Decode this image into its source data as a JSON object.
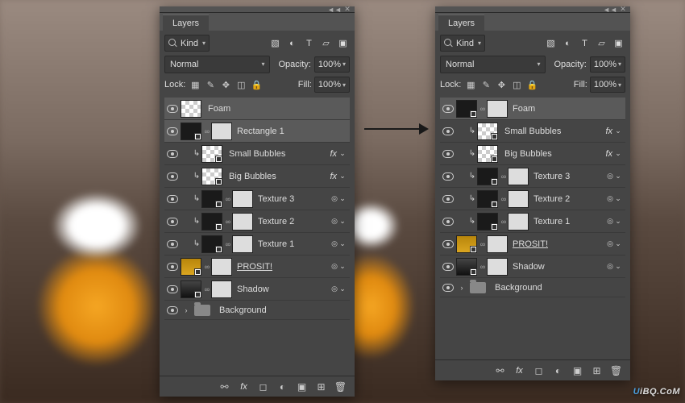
{
  "tabs": {
    "layers": "Layers"
  },
  "filter": {
    "kind": "Kind"
  },
  "blend": {
    "normal": "Normal"
  },
  "labels": {
    "opacity": "Opacity:",
    "lock": "Lock:",
    "fill": "Fill:"
  },
  "values": {
    "opacity": "100%",
    "fill": "100%"
  },
  "panelLeft": {
    "layers": {
      "foam": "Foam",
      "rectangle1": "Rectangle 1",
      "smallBubbles": "Small Bubbles",
      "bigBubbles": "Big Bubbles",
      "texture3": "Texture 3",
      "texture2": "Texture 2",
      "texture1": "Texture 1",
      "prosit": "PROSIT!",
      "shadow": "Shadow",
      "background": "Background"
    }
  },
  "panelRight": {
    "layers": {
      "foam": "Foam",
      "smallBubbles": "Small Bubbles",
      "bigBubbles": "Big Bubbles",
      "texture3": "Texture 3",
      "texture2": "Texture 2",
      "texture1": "Texture 1",
      "prosit": "PROSIT!",
      "shadow": "Shadow",
      "background": "Background"
    }
  },
  "fx": "fx",
  "watermark": {
    "prefix": "U",
    "rest": "iBQ.CoM"
  }
}
